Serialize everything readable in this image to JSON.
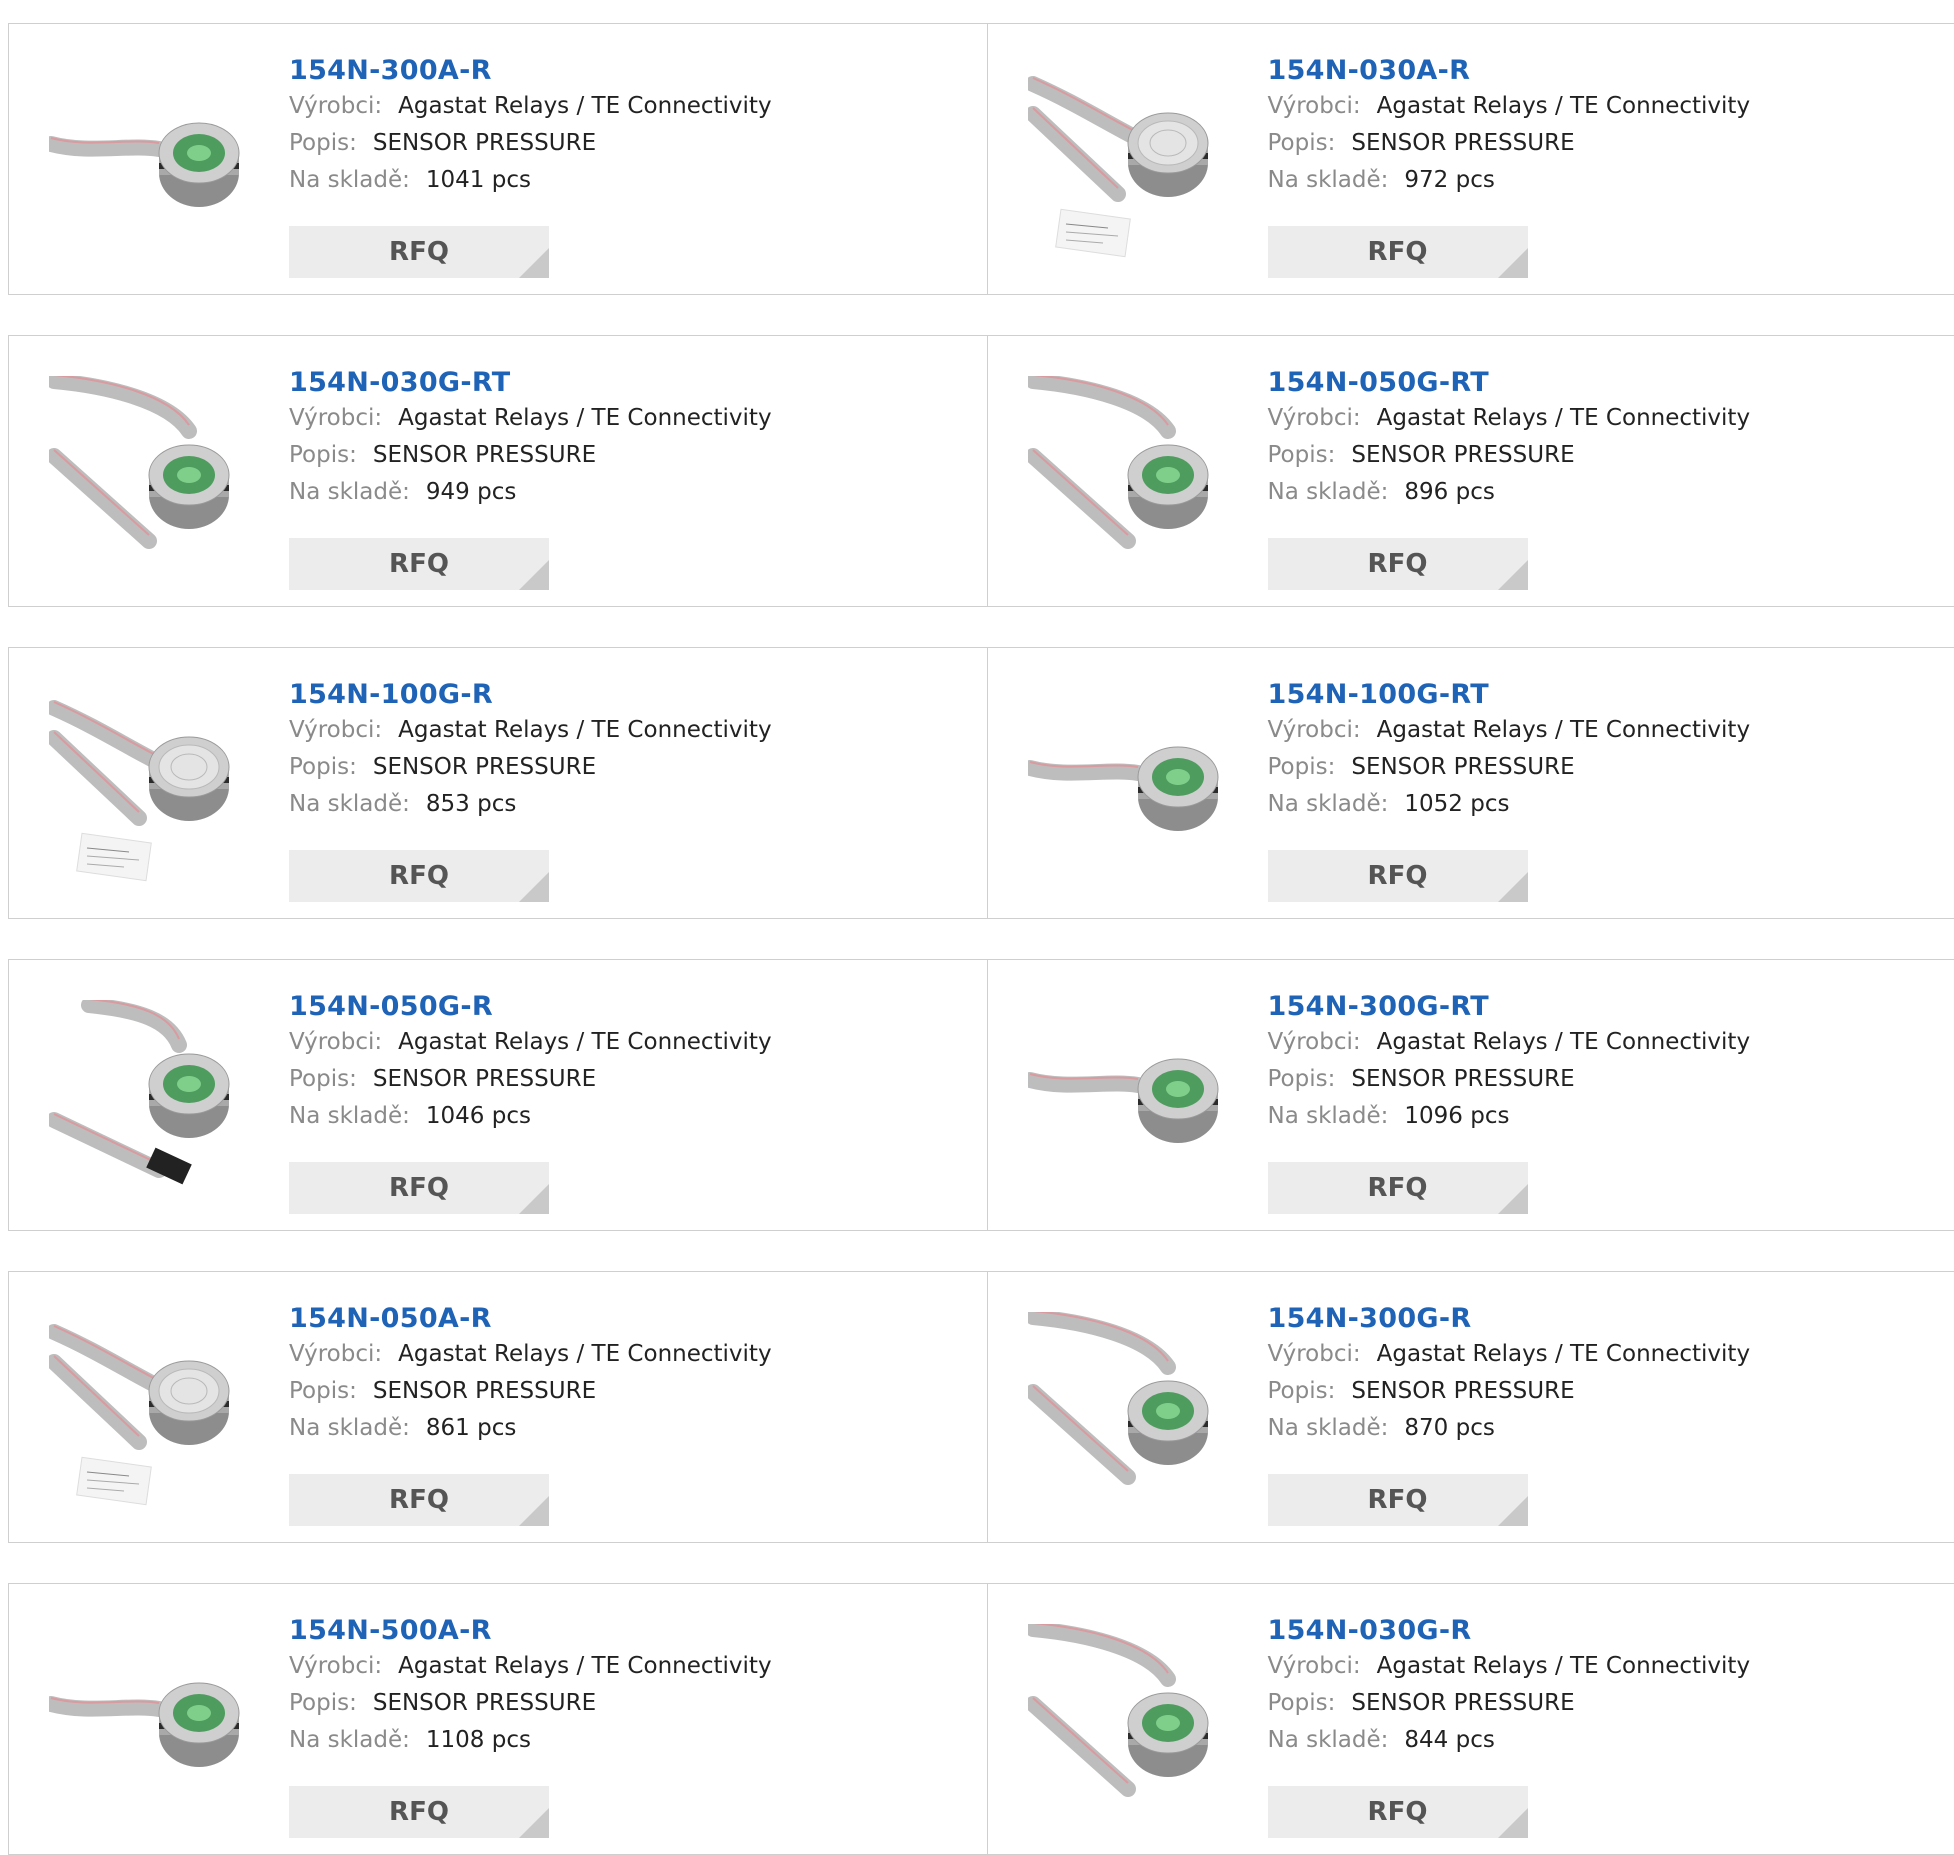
{
  "labels": {
    "manufacturer": "Výrobci:",
    "description": "Popis:",
    "stock": "Na skladě:",
    "rfq": "RFQ"
  },
  "colors": {
    "title": "#1f63b6",
    "button_bg": "#ececec",
    "border": "#cfcfcf"
  },
  "products": [
    {
      "part": "154N-300A-R",
      "manufacturer": "Agastat Relays / TE Connectivity",
      "description": "SENSOR PRESSURE",
      "stock": "1041 pcs",
      "image": "sensor-side-ribbon-icon"
    },
    {
      "part": "154N-030A-R",
      "manufacturer": "Agastat Relays / TE Connectivity",
      "description": "SENSOR PRESSURE",
      "stock": "972 pcs",
      "image": "sensor-flat-label-icon"
    },
    {
      "part": "154N-030G-RT",
      "manufacturer": "Agastat Relays / TE Connectivity",
      "description": "SENSOR PRESSURE",
      "stock": "949 pcs",
      "image": "sensor-ribbon-loop-icon"
    },
    {
      "part": "154N-050G-RT",
      "manufacturer": "Agastat Relays / TE Connectivity",
      "description": "SENSOR PRESSURE",
      "stock": "896 pcs",
      "image": "sensor-ribbon-loop-icon"
    },
    {
      "part": "154N-100G-R",
      "manufacturer": "Agastat Relays / TE Connectivity",
      "description": "SENSOR PRESSURE",
      "stock": "853 pcs",
      "image": "sensor-flat-label-icon"
    },
    {
      "part": "154N-100G-RT",
      "manufacturer": "Agastat Relays / TE Connectivity",
      "description": "SENSOR PRESSURE",
      "stock": "1052 pcs",
      "image": "sensor-side-ribbon-icon"
    },
    {
      "part": "154N-050G-R",
      "manufacturer": "Agastat Relays / TE Connectivity",
      "description": "SENSOR PRESSURE",
      "stock": "1046 pcs",
      "image": "sensor-connector-icon"
    },
    {
      "part": "154N-300G-RT",
      "manufacturer": "Agastat Relays / TE Connectivity",
      "description": "SENSOR PRESSURE",
      "stock": "1096 pcs",
      "image": "sensor-side-ribbon-icon"
    },
    {
      "part": "154N-050A-R",
      "manufacturer": "Agastat Relays / TE Connectivity",
      "description": "SENSOR PRESSURE",
      "stock": "861 pcs",
      "image": "sensor-flat-label-icon"
    },
    {
      "part": "154N-300G-R",
      "manufacturer": "Agastat Relays / TE Connectivity",
      "description": "SENSOR PRESSURE",
      "stock": "870 pcs",
      "image": "sensor-ribbon-loop-icon"
    },
    {
      "part": "154N-500A-R",
      "manufacturer": "Agastat Relays / TE Connectivity",
      "description": "SENSOR PRESSURE",
      "stock": "1108 pcs",
      "image": "sensor-side-ribbon-icon"
    },
    {
      "part": "154N-030G-R",
      "manufacturer": "Agastat Relays / TE Connectivity",
      "description": "SENSOR PRESSURE",
      "stock": "844 pcs",
      "image": "sensor-ribbon-loop-icon"
    }
  ]
}
